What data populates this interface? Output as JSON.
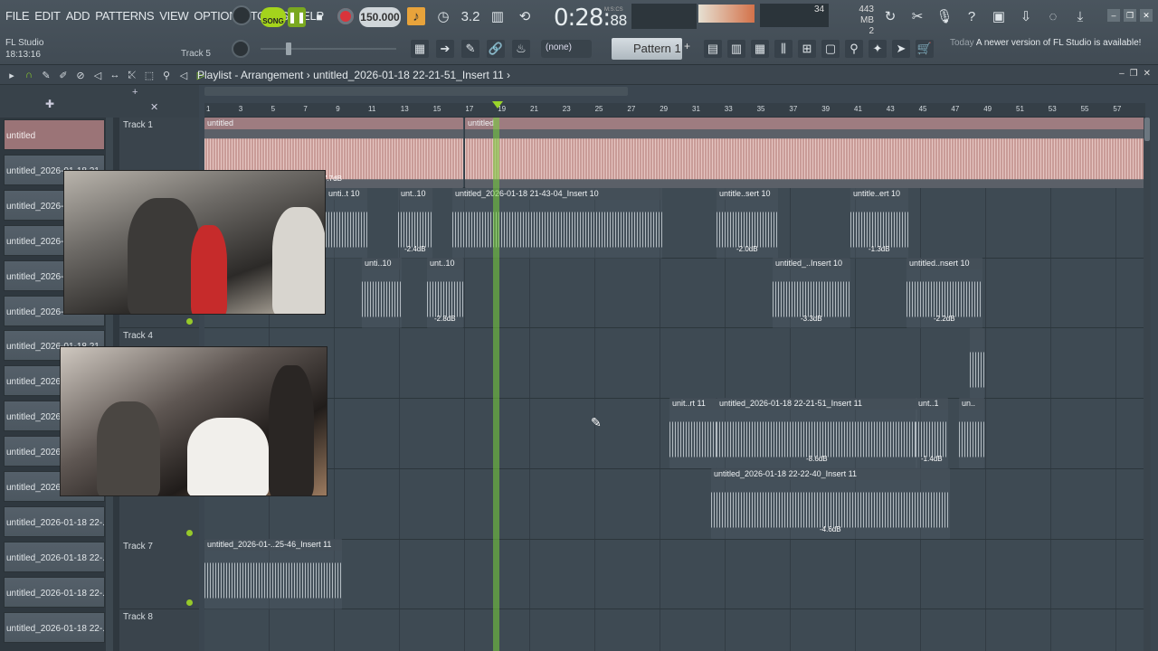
{
  "menu": [
    "FILE",
    "EDIT",
    "ADD",
    "PATTERNS",
    "VIEW",
    "OPTIONS",
    "TOOLS",
    "HELP"
  ],
  "transport": {
    "song_label": "SONG",
    "tempo": "150.000",
    "time": "0:28",
    "time_small": "88",
    "time_unit": "M:S:CS"
  },
  "meters": {
    "cpu_value": "34",
    "memory": "443 MB",
    "memory_sub": "2"
  },
  "app": {
    "title": "FL Studio",
    "clock": "18:13:16",
    "track_hint": "Track 5"
  },
  "pattern": {
    "selector": "(none)",
    "name": "Pattern 1",
    "plus": "+"
  },
  "news": {
    "label": "Today",
    "text": "A newer version of FL Studio is available!"
  },
  "playlist": {
    "title": "Playlist - Arrangement",
    "breadcrumb": "untitled_2026-01-18 22-21-51_Insert 11"
  },
  "ruler_ticks": [
    "1",
    "3",
    "5",
    "7",
    "9",
    "11",
    "13",
    "15",
    "17",
    "19",
    "21",
    "23",
    "25",
    "27",
    "29",
    "31",
    "33",
    "35",
    "37",
    "39",
    "41",
    "43",
    "45",
    "47",
    "49",
    "51",
    "53",
    "55",
    "57"
  ],
  "clip_list": [
    {
      "label": "untitled",
      "selected": true
    },
    {
      "label": "untitled_2026-01-18 21",
      "selected": false
    },
    {
      "label": "untitled_2026-0",
      "selected": false
    },
    {
      "label": "untitled_2026-0",
      "selected": false
    },
    {
      "label": "untitled_2026-0",
      "selected": false
    },
    {
      "label": "untitled_2026-0",
      "selected": false
    },
    {
      "label": "untitled_2026-01-18 21",
      "selected": false
    },
    {
      "label": "untitled_2026-0",
      "selected": false
    },
    {
      "label": "untitled_2026-0",
      "selected": false
    },
    {
      "label": "untitled_2026-0",
      "selected": false
    },
    {
      "label": "untitled_2026-0",
      "selected": false
    },
    {
      "label": "untitled_2026-01-18 22-...",
      "selected": false
    },
    {
      "label": "untitled_2026-01-18 22-...",
      "selected": false
    },
    {
      "label": "untitled_2026-01-18 22-...",
      "selected": false
    },
    {
      "label": "untitled_2026-01-18 22-...",
      "selected": false
    }
  ],
  "tracks": [
    {
      "name": "Track 1"
    },
    {
      "name": ""
    },
    {
      "name": ""
    },
    {
      "name": "Track 4"
    },
    {
      "name": ""
    },
    {
      "name": ""
    },
    {
      "name": "Track 7"
    },
    {
      "name": "Track 8"
    }
  ],
  "clips": {
    "t1a": {
      "label": "untitled",
      "db": "7.7dB"
    },
    "t1b": {
      "label": "untitled",
      "db": ""
    },
    "t2a": {
      "label": "unti..t 10",
      "db": ""
    },
    "t2b": {
      "label": "unt..10",
      "db": "-2.4dB"
    },
    "t2c": {
      "label": "untitled_2026-01-18 21-43-04_Insert 10",
      "db": ""
    },
    "t2d": {
      "label": "untitle..sert 10",
      "db": "-2.0dB"
    },
    "t2e": {
      "label": "untitle..ert 10",
      "db": "-1.3dB"
    },
    "t3a": {
      "label": "unti..10",
      "db": ""
    },
    "t3b": {
      "label": "unt..10",
      "db": "-2.8dB"
    },
    "t3c": {
      "label": "untitled_..Insert 10",
      "db": "-3.3dB"
    },
    "t3d": {
      "label": "untitled..nsert 10",
      "db": "-2.2dB"
    },
    "t4a": {
      "label": "",
      "db": ""
    },
    "t5a": {
      "label": "unit..rt 11",
      "db": ""
    },
    "t5b": {
      "label": "untitled_2026-01-18 22-21-51_Insert 11",
      "db": "-8.6dB"
    },
    "t5c": {
      "label": "unt..1",
      "db": "-1.4dB"
    },
    "t5d": {
      "label": "un..",
      "db": ""
    },
    "t6a": {
      "label": "untitled_2026-01-18 22-22-40_Insert 11",
      "db": "-4.6dB"
    },
    "t7a": {
      "label": "untitled_2026-01-..25-46_Insert 11",
      "db": ""
    }
  }
}
